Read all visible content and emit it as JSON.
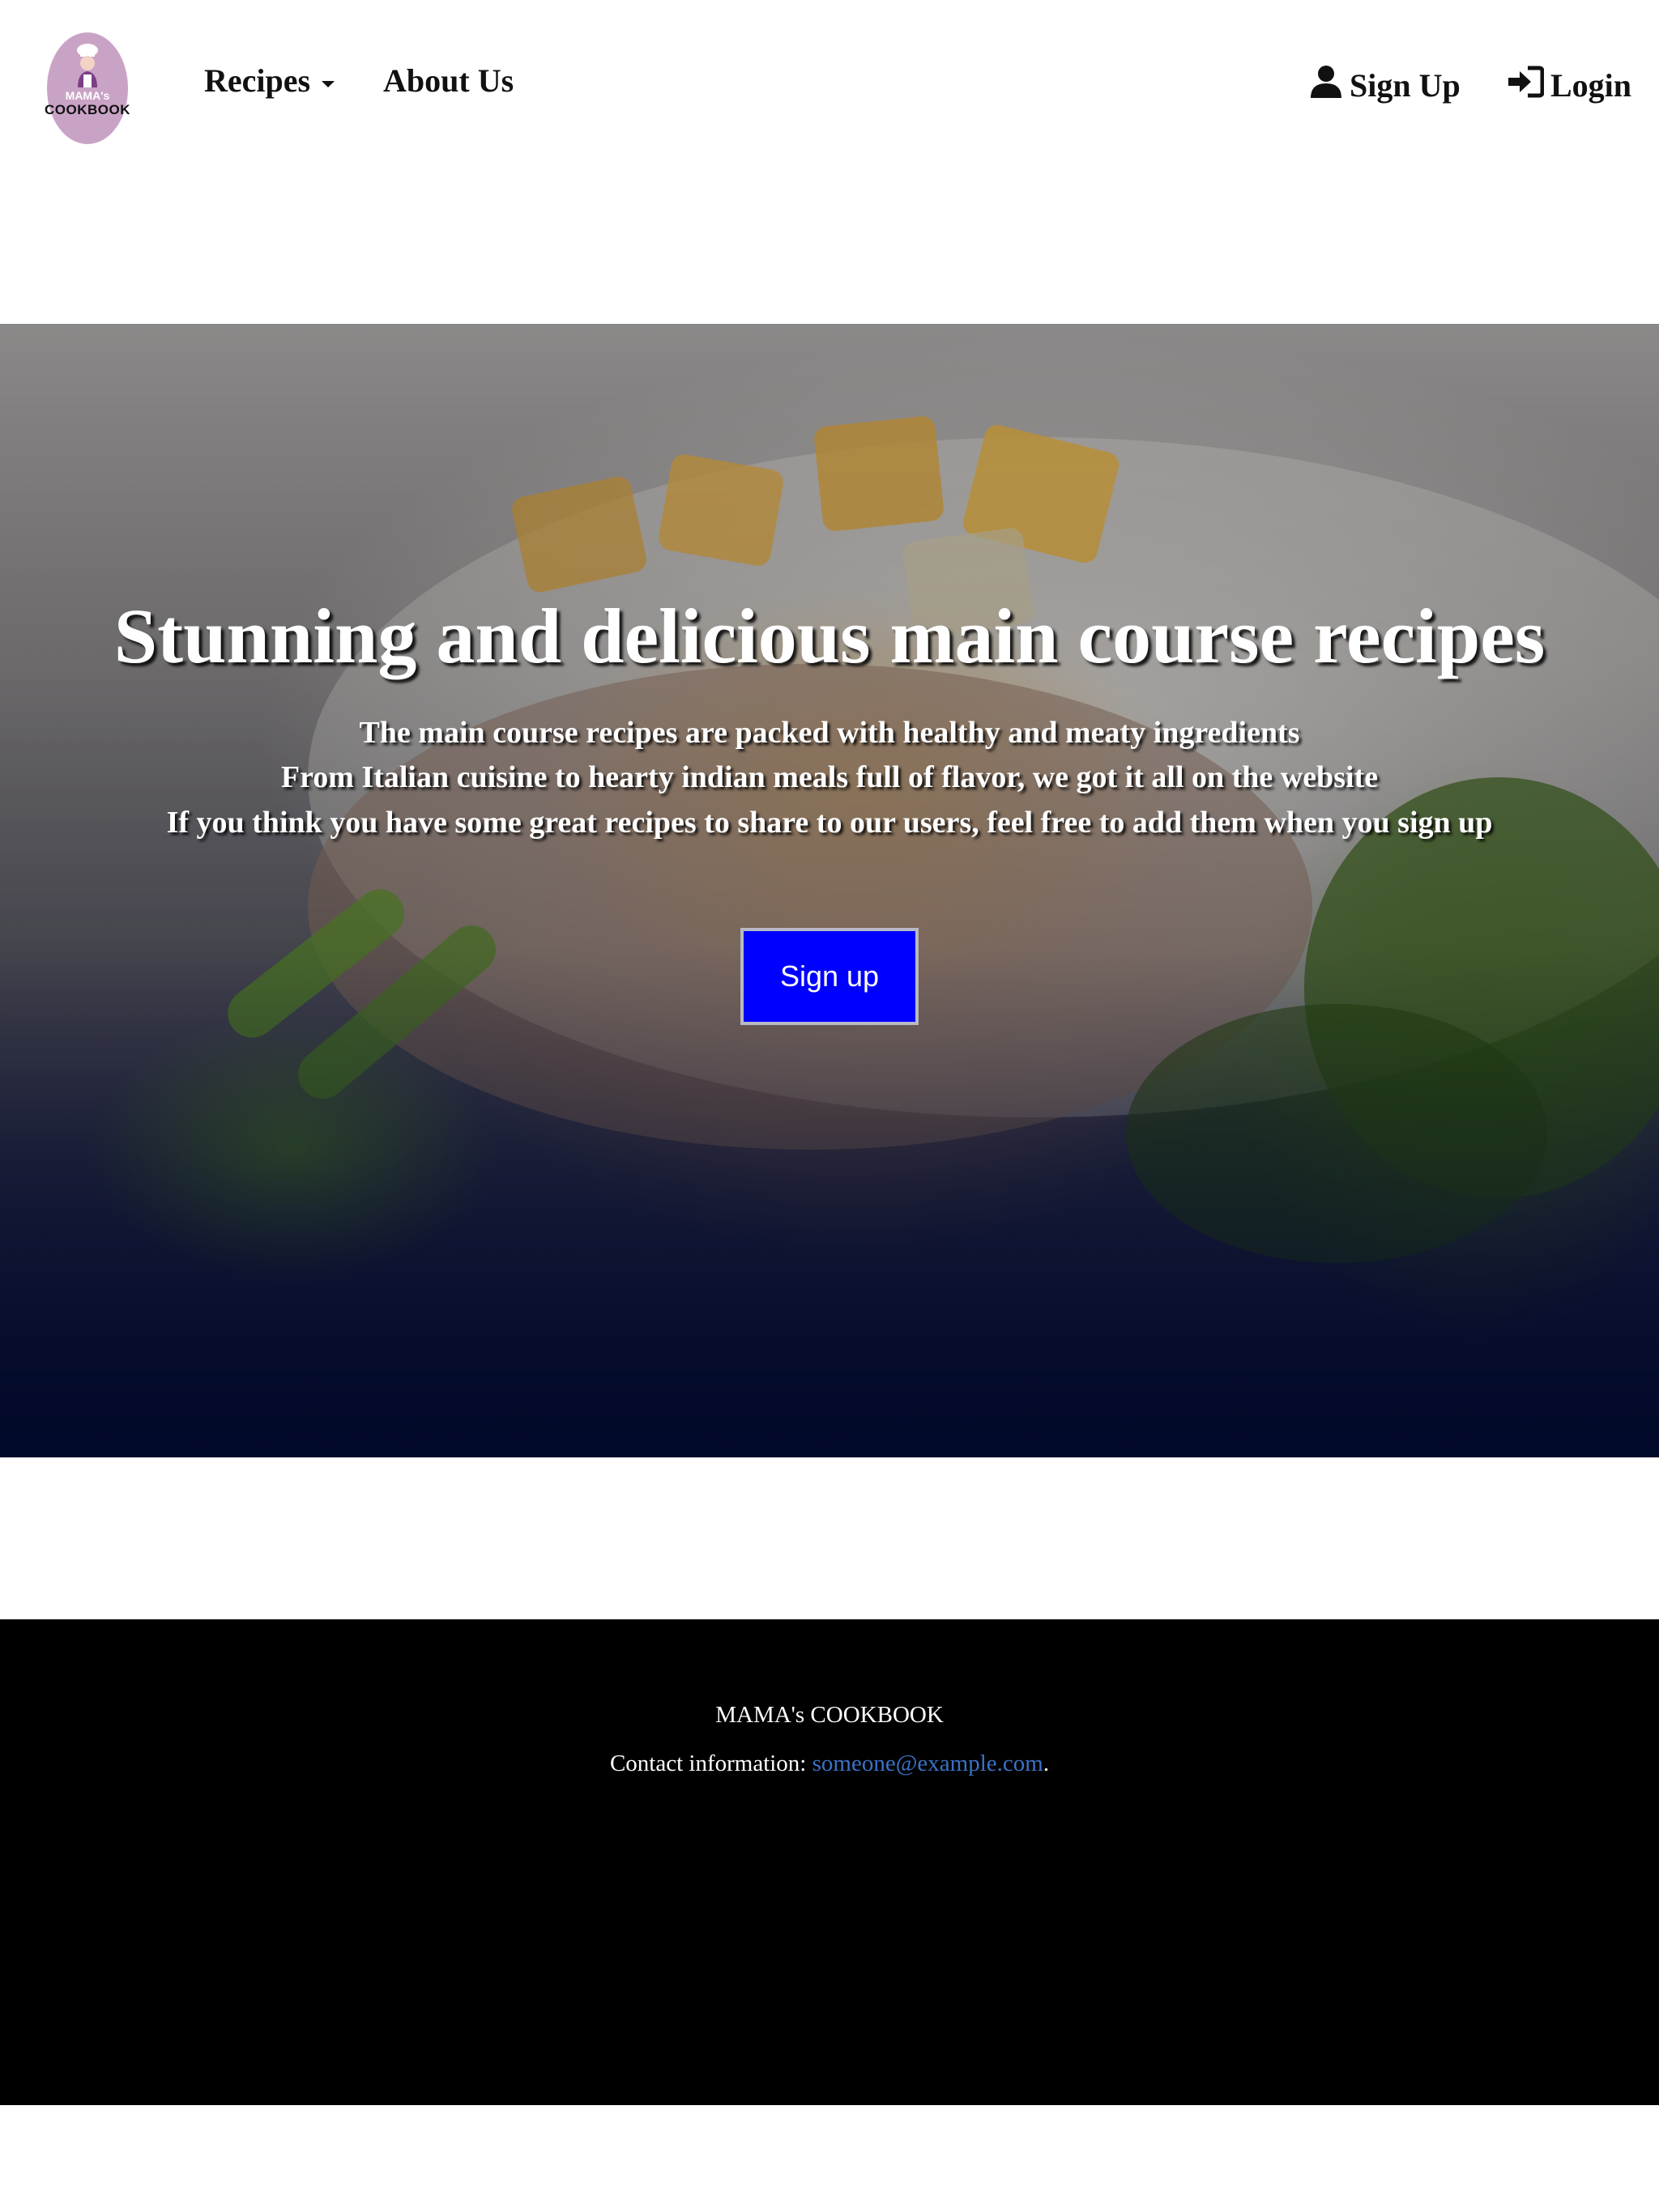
{
  "brand": {
    "logo_line1": "MAMA's",
    "logo_line2": "COOKBOOK"
  },
  "nav": {
    "recipes_label": "Recipes",
    "about_label": "About Us",
    "signup_label": "Sign Up",
    "login_label": "Login",
    "icons": [
      "caret-down-icon",
      "user-icon",
      "login-icon"
    ]
  },
  "hero": {
    "title": "Stunning and delicious main course recipes",
    "line1": "The main course recipes are packed with healthy and meaty ingredients",
    "line2": "From Italian cuisine to hearty indian meals full of flavor, we got it all on the website",
    "line3": "If you think you have some great recipes to share to our users, feel free to add them when you sign up",
    "button_label": "Sign up",
    "button_color": "#0000ff"
  },
  "footer": {
    "brand": "MAMA's COOKBOOK",
    "contact_prefix": "Contact information: ",
    "contact_email": "someone@example.com",
    "contact_suffix": ".",
    "link_color": "#3a72c7"
  }
}
